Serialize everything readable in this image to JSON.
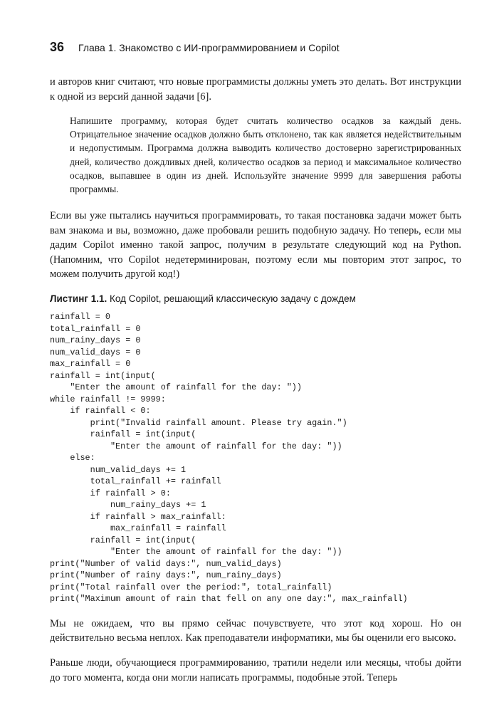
{
  "header": {
    "page_number": "36",
    "chapter_title": "Глава 1. Знакомство с ИИ-программированием и Copilot"
  },
  "body": {
    "p1": "и авторов книг считают, что новые программисты должны уметь это делать. Вот инструкции к одной из версий данной задачи [6].",
    "quote": "Напишите программу, которая будет считать количество осадков за каждый день. Отрицательное значение осадков должно быть отклонено, так как является недействительным и недопустимым. Программа должна выводить количество достоверно зарегистрированных дней, количество дождливых дней, количество осадков за период и максимальное количество осадков, выпавшее в один из дней. Используйте значение 9999 для завершения работы программы.",
    "p2": "Если вы уже пытались научиться программировать, то такая постановка задачи может быть вам знакома и вы, возможно, даже пробовали решить подобную задачу. Но теперь, если мы дадим Copilot именно такой запрос, получим в результате следующий код на Python. (Напомним, что Copilot недетерминирован, поэтому если мы повторим этот запрос, то можем получить другой код!)",
    "listing_label": "Листинг 1.1.",
    "listing_title": " Код Copilot, решающий классическую задачу с дождем",
    "code": "rainfall = 0\ntotal_rainfall = 0\nnum_rainy_days = 0\nnum_valid_days = 0\nmax_rainfall = 0\nrainfall = int(input(\n    \"Enter the amount of rainfall for the day: \"))\nwhile rainfall != 9999:\n    if rainfall < 0:\n        print(\"Invalid rainfall amount. Please try again.\")\n        rainfall = int(input(\n            \"Enter the amount of rainfall for the day: \"))\n    else:\n        num_valid_days += 1\n        total_rainfall += rainfall\n        if rainfall > 0:\n            num_rainy_days += 1\n        if rainfall > max_rainfall:\n            max_rainfall = rainfall\n        rainfall = int(input(\n            \"Enter the amount of rainfall for the day: \"))\nprint(\"Number of valid days:\", num_valid_days)\nprint(\"Number of rainy days:\", num_rainy_days)\nprint(\"Total rainfall over the period:\", total_rainfall)\nprint(\"Maximum amount of rain that fell on any one day:\", max_rainfall)",
    "p3": "Мы не ожидаем, что вы прямо сейчас почувствуете, что этот код хорош. Но он действительно весьма неплох. Как преподаватели информатики, мы бы оценили его высоко.",
    "p4": "Раньше люди, обучающиеся программированию, тратили недели или месяцы, чтобы дойти до того момента, когда они могли написать программы, подобные этой. Теперь"
  }
}
